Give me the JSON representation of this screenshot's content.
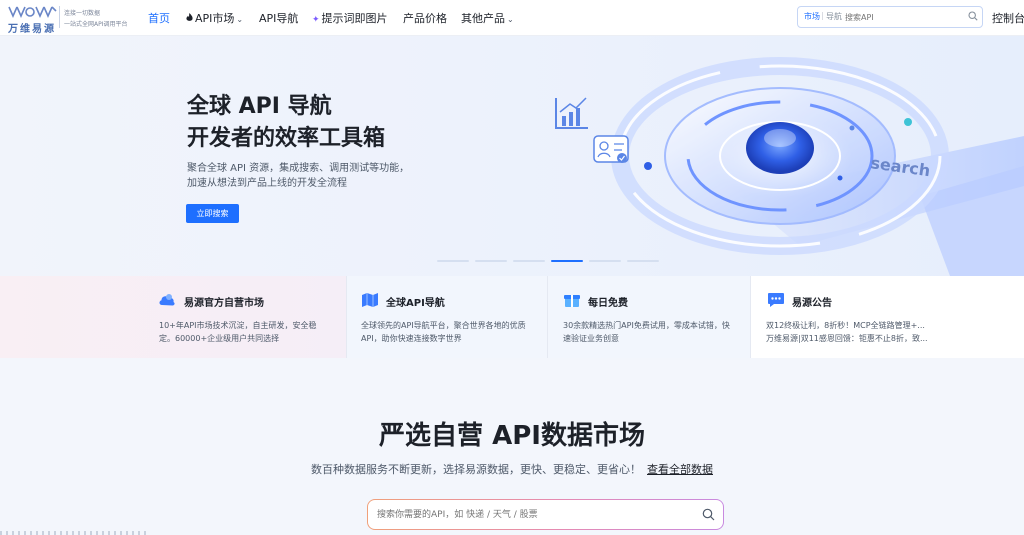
{
  "header": {
    "logo_name": "万维易源",
    "logo_tagline_1": "连接一切数据",
    "logo_tagline_2": "一站式全网API调用平台",
    "nav": [
      {
        "label": "首页",
        "active": true
      },
      {
        "label": "API市场",
        "icon": "fire-icon",
        "has_dropdown": true
      },
      {
        "label": "API导航"
      },
      {
        "label": "提示词即图片",
        "icon": "sparkle-icon"
      },
      {
        "label": "产品价格"
      },
      {
        "label": "其他产品",
        "has_dropdown": true
      }
    ],
    "search": {
      "tab_active": "市场",
      "tab_other": "导航",
      "placeholder": "搜索API"
    },
    "console_label": "控制台"
  },
  "hero": {
    "title_line_1": "全球 API 导航",
    "title_line_2": "开发者的效率工具箱",
    "desc_line_1": "聚合全球 API 资源，集成搜索、调用测试等功能，",
    "desc_line_2": "加速从想法到产品上线的开发全流程",
    "cta_label": "立即搜索",
    "art_label": "search",
    "carousel_total": 6,
    "carousel_active_index": 3
  },
  "features": [
    {
      "icon": "cloud-icon",
      "title": "易源官方自营市场",
      "line_1": "10+年API市场技术沉淀，自主研发，安全稳",
      "line_2": "定。60000+企业级用户共同选择"
    },
    {
      "icon": "map-icon",
      "title": "全球API导航",
      "line_1": "全球领先的API导航平台，聚合世界各地的优质",
      "line_2": "API，助你快速连接数字世界"
    },
    {
      "icon": "gift-icon",
      "title": "每日免费",
      "line_1": "30余款精选热门API免费试用，零成本试错，快",
      "line_2": "速验证业务创意"
    },
    {
      "icon": "chat-bubble-icon",
      "title": "易源公告",
      "line_1": "双12终极让利，8折秒！MCP全链路管理+...",
      "line_2": "万维易源|双11感恩回馈：钜惠不止8折，致..."
    }
  ],
  "market": {
    "title": "严选自营 API数据市场",
    "subtitle": "数百种数据服务不断更新，选择易源数据，更快、更稳定、更省心！",
    "view_all_label": "查看全部数据",
    "search_placeholder": "搜索你需要的API，如 快递 / 天气 / 股票"
  },
  "colors": {
    "accent": "#1e6fff",
    "text": "#1d2129",
    "muted": "#4e5969"
  }
}
